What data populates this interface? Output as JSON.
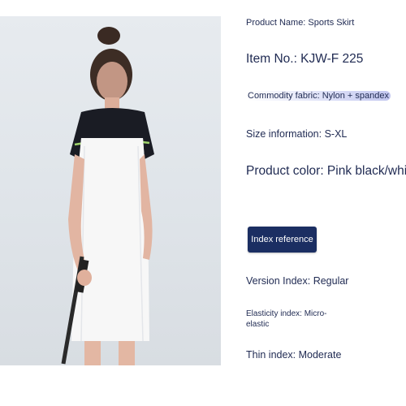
{
  "product": {
    "name": "Product Name: Sports Skirt",
    "item_no": "Item No.: KJW-F 225",
    "fabric": "Commodity fabric: Nylon + spandex",
    "size": "Size information: S-XL",
    "color": "Product color: Pink black/white",
    "index_button": "Index reference",
    "version_index": "Version Index: Regular",
    "elasticity_index": "Elasticity index: Micro-elastic",
    "thin_index": "Thin index: Moderate"
  },
  "colors": {
    "text": "#1f2a52",
    "button_bg": "#1b2e62",
    "button_text": "#ffffff",
    "photo_bg": "#e3e7ec"
  },
  "image": {
    "subject": "model-wearing-sports-dress-with-golf-club"
  }
}
